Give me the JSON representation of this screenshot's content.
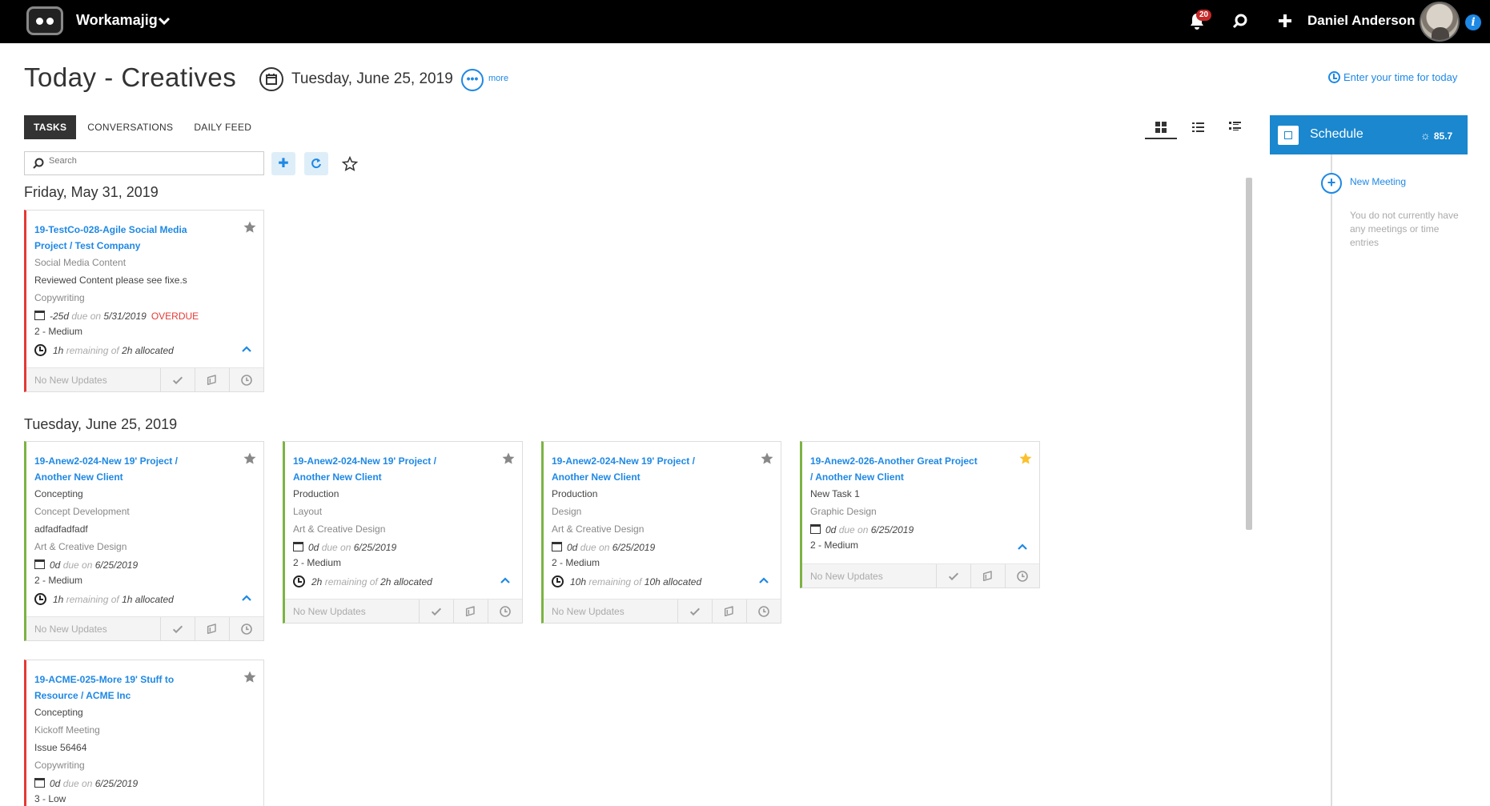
{
  "topbar": {
    "app_name": "Workamajig",
    "notification_count": "20",
    "user_name": "Daniel Anderson"
  },
  "header": {
    "title": "Today - Creatives",
    "date": "Tuesday, June 25, 2019",
    "more_label": "more",
    "enter_time": "Enter your time for today"
  },
  "tabs": [
    {
      "label": "TASKS",
      "active": true
    },
    {
      "label": "CONVERSATIONS",
      "active": false
    },
    {
      "label": "DAILY FEED",
      "active": false
    }
  ],
  "toolbar": {
    "search_placeholder": "Search",
    "add_icon": "plus-icon",
    "refresh_icon": "refresh-icon",
    "favorite_icon": "star-icon"
  },
  "sections": [
    {
      "date": "Friday, May 31, 2019",
      "cards": [
        {
          "title": "19-TestCo-028-Agile Social Media Project / Test Company",
          "lines": [
            "Social Media Content",
            "Reviewed Content please see fixe.s",
            "Copywriting"
          ],
          "due_days": "-25d",
          "due_label": "due on",
          "due_date": "5/31/2019",
          "overdue": "OVERDUE",
          "priority": "2 - Medium",
          "remaining": "1h",
          "remaining_label": "remaining of",
          "allocated": "2h allocated",
          "footer": "No New Updates",
          "starred": false,
          "status_color": "#e53935"
        }
      ]
    },
    {
      "date": "Tuesday, June 25, 2019",
      "cards": [
        {
          "title": "19-Anew2-024-New 19' Project / Another New Client",
          "lines": [
            "Concepting",
            "Concept Development",
            "adfadfadfadf",
            "Art & Creative Design"
          ],
          "due_days": "0d",
          "due_label": "due on",
          "due_date": "6/25/2019",
          "priority": "2 - Medium",
          "remaining": "1h",
          "remaining_label": "remaining of",
          "allocated": "1h allocated",
          "footer": "No New Updates",
          "starred": false,
          "status_color": "#7cb342"
        },
        {
          "title": "19-Anew2-024-New 19' Project / Another New Client",
          "lines": [
            "Production",
            "Layout",
            "Art & Creative Design"
          ],
          "due_days": "0d",
          "due_label": "due on",
          "due_date": "6/25/2019",
          "priority": "2 - Medium",
          "remaining": "2h",
          "remaining_label": "remaining of",
          "allocated": "2h allocated",
          "footer": "No New Updates",
          "starred": false,
          "status_color": "#7cb342"
        },
        {
          "title": "19-Anew2-024-New 19' Project / Another New Client",
          "lines": [
            "Production",
            "Design",
            "Art & Creative Design"
          ],
          "due_days": "0d",
          "due_label": "due on",
          "due_date": "6/25/2019",
          "priority": "2 - Medium",
          "remaining": "10h",
          "remaining_label": "remaining of",
          "allocated": "10h allocated",
          "footer": "No New Updates",
          "starred": false,
          "status_color": "#7cb342"
        },
        {
          "title": "19-Anew2-026-Another Great Project / Another New Client",
          "lines": [
            "New Task 1",
            "Graphic Design"
          ],
          "due_days": "0d",
          "due_label": "due on",
          "due_date": "6/25/2019",
          "priority": "2 - Medium",
          "footer": "No New Updates",
          "starred": true,
          "status_color": "#7cb342"
        },
        {
          "title": "19-ACME-025-More 19' Stuff to Resource / ACME Inc",
          "lines": [
            "Concepting",
            "Kickoff Meeting",
            "Issue 56464",
            "Copywriting"
          ],
          "due_days": "0d",
          "due_label": "due on",
          "due_date": "6/25/2019",
          "priority": "3 - Low",
          "starred": false,
          "status_color": "#e53935"
        }
      ]
    }
  ],
  "schedule": {
    "title": "Schedule",
    "score": "85.7",
    "new_meeting": "New Meeting",
    "empty_message": "You do not currently have any meetings or time entries"
  },
  "colors": {
    "accent": "#1e88e5",
    "overdue": "#e53935",
    "on_track": "#7cb342",
    "schedule_header": "#1a87cf",
    "star_active": "#fbc02d"
  }
}
